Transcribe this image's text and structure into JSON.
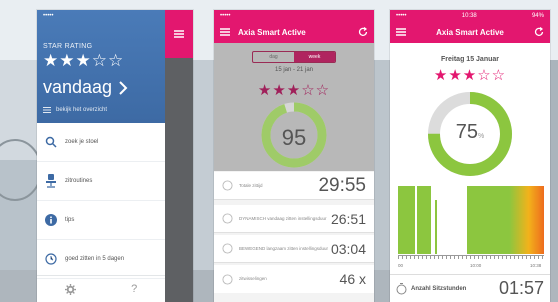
{
  "colors": {
    "accent": "#e3176f",
    "blue": "#3d6aa4",
    "green": "#8cc63f"
  },
  "phone1": {
    "star_rating_label": "STAR RATING",
    "stars": "★★★☆☆",
    "day": "vandaag",
    "overview_label": "bekijk het overzicht",
    "menu": [
      {
        "icon": "search-icon",
        "label": "zoek je stoel"
      },
      {
        "icon": "chair-icon",
        "label": "zitroutines"
      },
      {
        "icon": "info-icon",
        "label": "tips"
      },
      {
        "icon": "clock-icon",
        "label": "goed zitten in 5 dagen"
      }
    ],
    "footer_icons": [
      "gear-icon",
      "help-icon"
    ],
    "help_symbol": "?"
  },
  "phone2": {
    "title": "Axia Smart Active",
    "segments": [
      "dag",
      "week"
    ],
    "date": "15 jan - 21 jan",
    "stars": "★★★☆☆",
    "gauge_value": "95",
    "gauge_fraction": 0.95,
    "rows": [
      {
        "label": "Totale zittijd",
        "value": "29:55"
      },
      {
        "label": "DYNAMISCH vandaag zitten instellingsduur",
        "value": "26:51"
      },
      {
        "label": "BEWEGEND langzaam zitten instellingsduur",
        "value": "03:04"
      },
      {
        "label": "zitwisselingen",
        "value": "46 x"
      }
    ]
  },
  "phone3": {
    "time": "10:38",
    "battery": "94%",
    "title": "Axia Smart Active",
    "date": "Freitag 15 Januar",
    "stars": "★★★☆☆",
    "gauge_value": "75",
    "gauge_unit": "%",
    "gauge_fraction": 0.75,
    "tick_labels": [
      "00",
      "10:00",
      "10:38"
    ],
    "footer_label": "Anzahl Sitzstunden",
    "footer_value": "01:57"
  }
}
